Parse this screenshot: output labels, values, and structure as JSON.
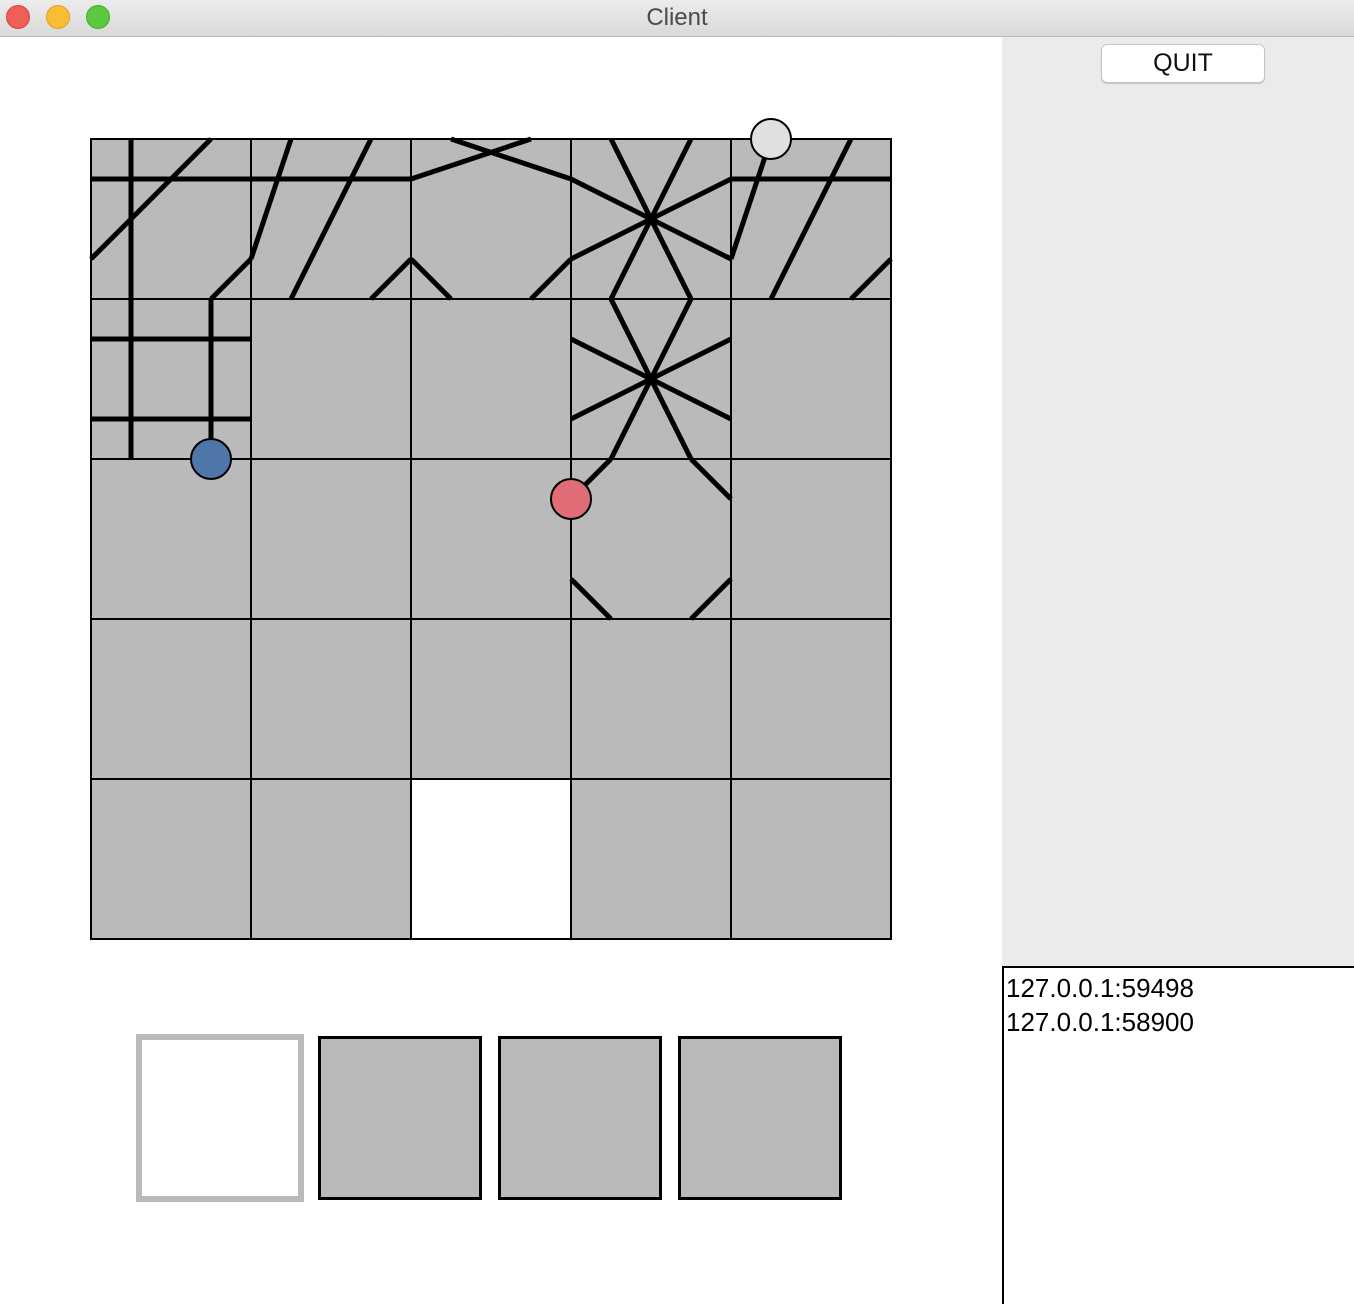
{
  "window": {
    "title": "Client",
    "controls": [
      "close",
      "minimize",
      "zoom"
    ]
  },
  "toolbar": {
    "quit_label": "QUIT"
  },
  "players": {
    "connections": [
      "127.0.0.1:59498",
      "127.0.0.1:58900"
    ]
  },
  "board": {
    "rows": 5,
    "cols": 5,
    "empty_cells": [
      [
        4,
        2
      ]
    ],
    "colors": {
      "tile": "#bababa",
      "empty": "#ffffff",
      "grid_line": "#000000",
      "path": "#000000"
    },
    "tokens": [
      {
        "name": "white-player-token",
        "color": "#e0e0e0"
      },
      {
        "name": "blue-player-token",
        "color": "#4f76a8"
      },
      {
        "name": "red-player-token",
        "color": "#e06c77"
      }
    ]
  },
  "hand": {
    "tiles": [
      {
        "state": "selected",
        "fill": "#ffffff",
        "border": "#bababa"
      },
      {
        "state": "normal",
        "fill": "#bababa",
        "border": "#000000"
      },
      {
        "state": "normal",
        "fill": "#bababa",
        "border": "#000000"
      },
      {
        "state": "normal",
        "fill": "#bababa",
        "border": "#000000"
      }
    ]
  }
}
